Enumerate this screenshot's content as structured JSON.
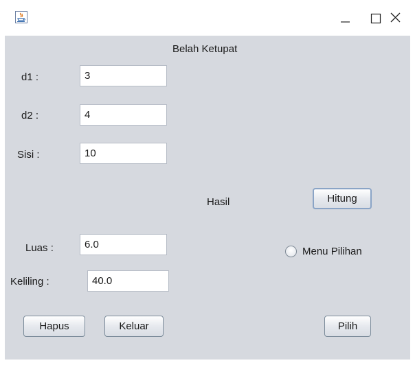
{
  "window": {
    "title": "",
    "icon": "java-app-icon",
    "controls": {
      "minimize": "minimize-icon",
      "maximize": "maximize-icon",
      "close": "close-icon"
    }
  },
  "form": {
    "heading": "Belah Ketupat",
    "d1": {
      "label": "d1 :",
      "value": "3"
    },
    "d2": {
      "label": "d2 :",
      "value": "4"
    },
    "sisi": {
      "label": "Sisi :",
      "value": "10"
    },
    "hasil_label": "Hasil",
    "hitung_button": "Hitung",
    "luas": {
      "label": "Luas :",
      "value": "6.0"
    },
    "keliling": {
      "label": "Keliling :",
      "value": "40.0"
    },
    "menu_pilihan": "Menu Pilihan",
    "hapus_button": "Hapus",
    "keluar_button": "Keluar",
    "pilih_button": "Pilih"
  },
  "colors": {
    "panel_background": "#d6d9df",
    "focus_border": "#8aa4c6"
  }
}
